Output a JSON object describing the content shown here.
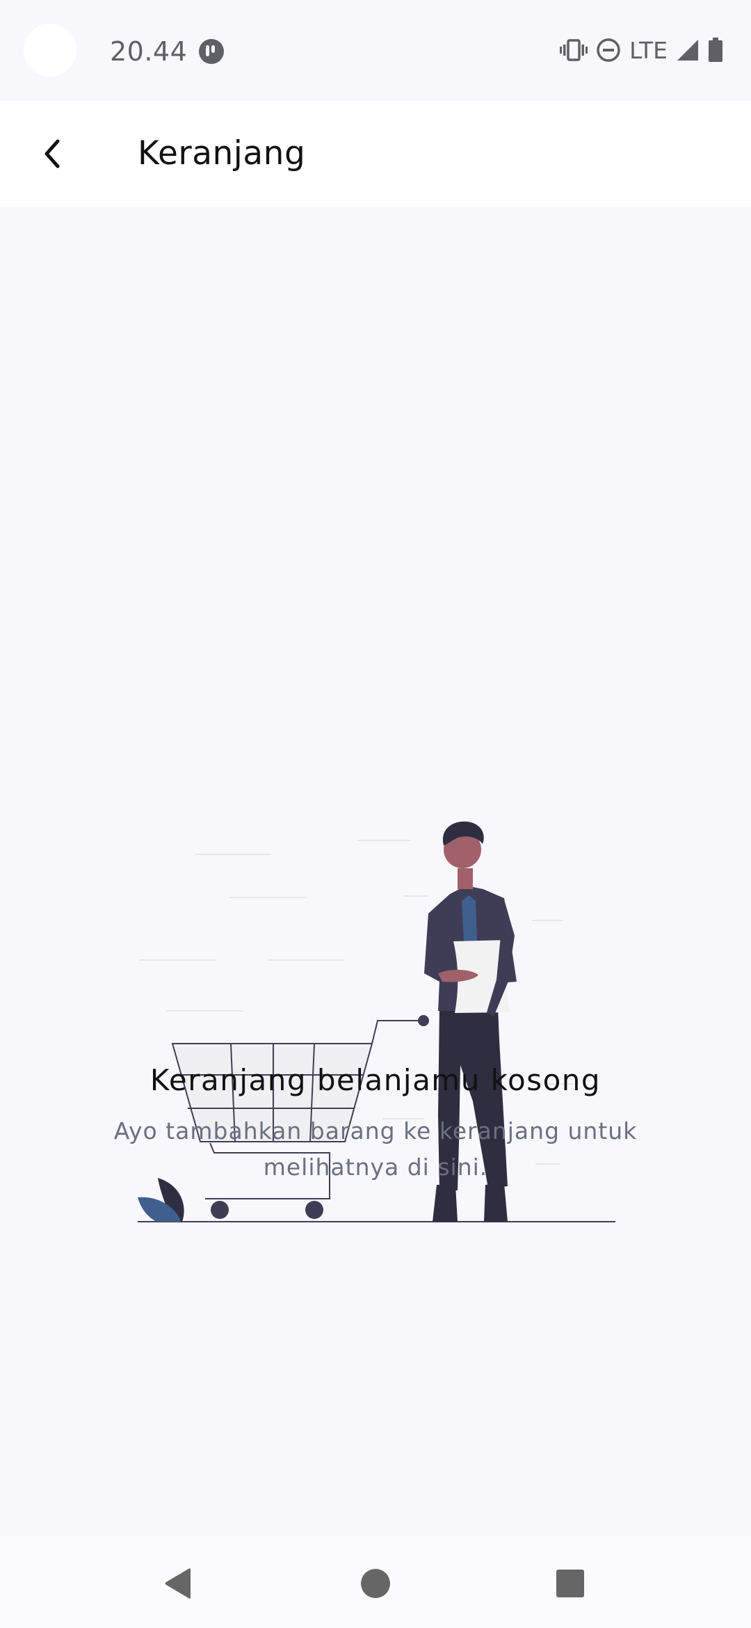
{
  "status_bar": {
    "time": "20.44",
    "network_label": "LTE",
    "icons": [
      "app-notification-icon",
      "vibrate-icon",
      "do-not-disturb-icon",
      "signal-icon",
      "battery-icon"
    ]
  },
  "app_bar": {
    "title": "Keranjang",
    "back_icon": "chevron-left-icon"
  },
  "empty_state": {
    "illustration": "empty-cart-illustration",
    "title": "Keranjang belanjamu kosong",
    "message": "Ayo tambahkan barang ke keranjang untuk melihatnya di sini."
  },
  "nav_bar": {
    "icons": [
      "back-triangle-icon",
      "home-circle-icon",
      "recents-square-icon"
    ]
  },
  "colors": {
    "background": "#f8f7fc",
    "app_bar": "#ffffff",
    "title_text": "#111111",
    "message_text": "#6b6f80",
    "figure_dark": "#2f2e41",
    "jacket": "#3f3d56",
    "skin": "#a0616a",
    "leaf": "#3f5f8f"
  }
}
